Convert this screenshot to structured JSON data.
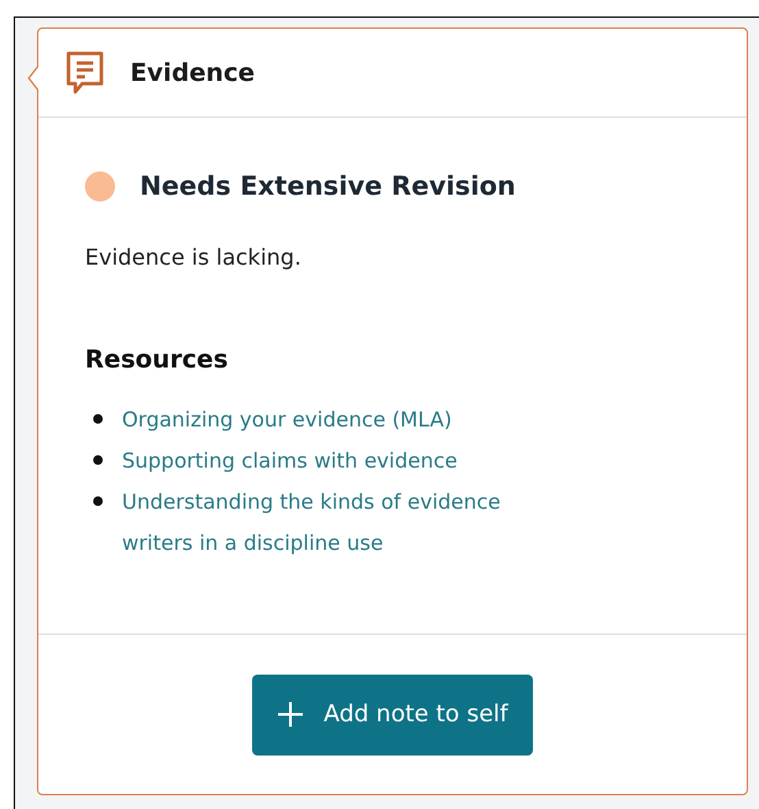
{
  "panel": {
    "title": "Evidence"
  },
  "status": {
    "label": "Needs Extensive Revision",
    "color": "#f9bb92"
  },
  "comment": "Evidence is lacking.",
  "resources": {
    "heading": "Resources",
    "links": [
      {
        "label": "Organizing your evidence (MLA)"
      },
      {
        "label": "Supporting claims with evidence"
      },
      {
        "label": "Understanding the kinds of evidence writers in a discipline use"
      }
    ]
  },
  "buttons": [
    {
      "label": "Add note to self",
      "kind": "add"
    }
  ]
}
